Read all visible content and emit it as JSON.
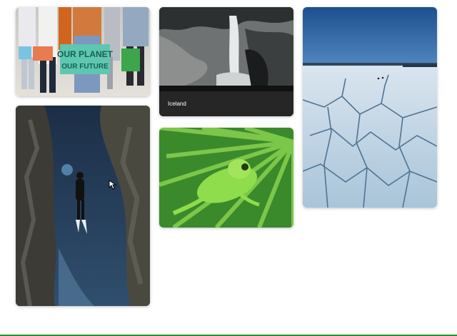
{
  "gallery": {
    "cards": [
      {
        "image_desc": "climate-protest-photo"
      },
      {
        "image_desc": "waterfall-cave-photo",
        "caption": "Iceland"
      },
      {
        "image_desc": "frozen-lake-photo"
      },
      {
        "image_desc": "diver-underwater-photo"
      },
      {
        "image_desc": "green-tree-frog-photo"
      }
    ],
    "sign_texts": [
      "OUR PLANET",
      "OUR FUTURE"
    ]
  },
  "colors": {
    "caption_bg": "#262626",
    "bottom_bar": "#2f8b2f"
  }
}
